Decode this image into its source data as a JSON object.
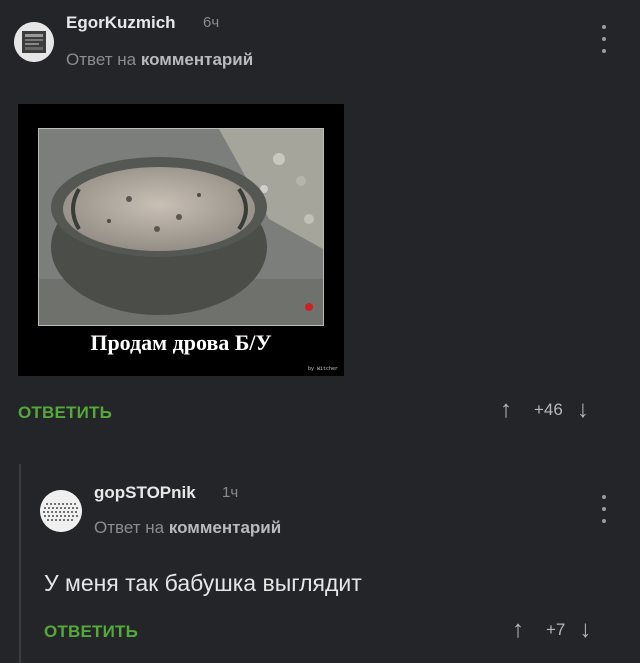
{
  "comment1": {
    "username": "EgorKuzmich",
    "time": "6ч",
    "reply_prefix": "Ответ на",
    "reply_target": "комментарий",
    "image": {
      "caption": "Продам дрова Б/У",
      "credit": "by Witcher"
    },
    "reply_button": "ОТВЕТИТЬ",
    "rating": "+46",
    "icons": {
      "menu": "more-vertical-icon",
      "up": "arrow-up-icon",
      "down": "arrow-down-icon"
    }
  },
  "comment2": {
    "username": "gopSTOPnik",
    "time": "1ч",
    "reply_prefix": "Ответ на",
    "reply_target": "комментарий",
    "text": "У меня так бабушка выглядит",
    "reply_button": "ОТВЕТИТЬ",
    "rating": "+7",
    "icons": {
      "menu": "more-vertical-icon",
      "up": "arrow-up-icon",
      "down": "arrow-down-icon"
    }
  },
  "colors": {
    "background": "#232528",
    "accent": "#55a83a",
    "muted": "#8a8c8f"
  }
}
